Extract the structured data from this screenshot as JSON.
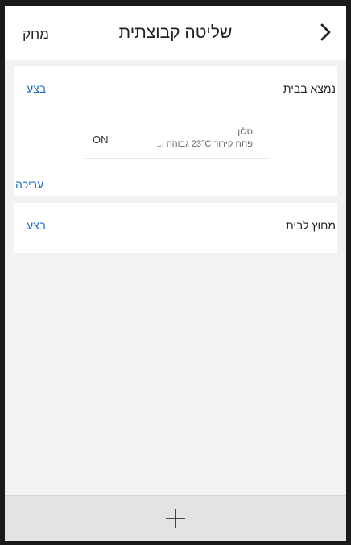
{
  "header": {
    "title": "שליטה קבוצתית",
    "delete_label": "מחק",
    "back_icon": "chevron-right-icon"
  },
  "groups": [
    {
      "title": "נמצא בבית",
      "execute_label": "בצע",
      "devices": [
        {
          "name": "סלון",
          "description": "פתח קירור 23°C גבוהה ...",
          "state": "ON"
        }
      ],
      "edit_label": "עריכה"
    },
    {
      "title": "מחוץ לבית",
      "execute_label": "בצע"
    }
  ],
  "footer": {
    "add_icon": "plus-icon"
  },
  "colors": {
    "accent": "#1e6fd0",
    "background": "#f2f2f2",
    "card": "#ffffff",
    "footer": "#e3e3e3"
  }
}
